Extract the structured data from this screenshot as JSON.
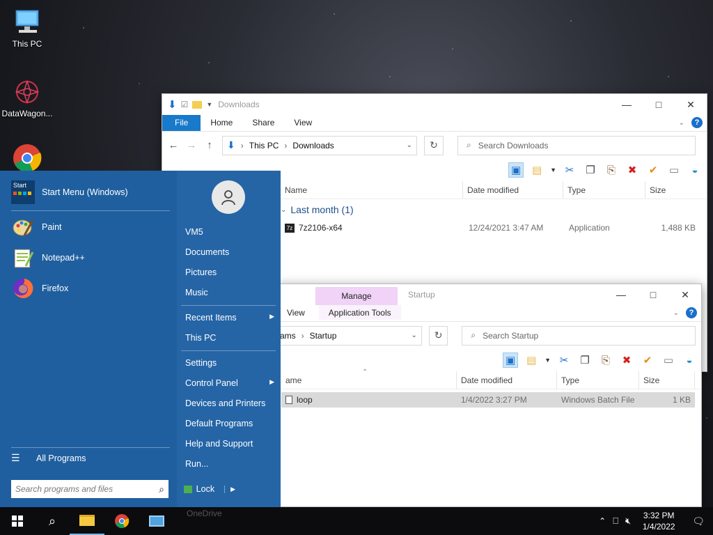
{
  "desktop": {
    "icons": [
      {
        "label": "This PC",
        "icon": "this-pc-icon"
      },
      {
        "label": "DataWagon...",
        "icon": "datawagon-icon"
      },
      {
        "label": "",
        "icon": "chrome-icon"
      }
    ]
  },
  "downloads_window": {
    "title": "Downloads",
    "tabs": {
      "file": "File",
      "home": "Home",
      "share": "Share",
      "view": "View"
    },
    "address": {
      "root": "This PC",
      "folder": "Downloads"
    },
    "search_placeholder": "Search Downloads",
    "columns": {
      "name": "Name",
      "date": "Date modified",
      "type": "Type",
      "size": "Size"
    },
    "group": "Last month (1)",
    "rows": [
      {
        "name": "7z2106-x64",
        "date": "12/24/2021 3:47 AM",
        "type": "Application",
        "size": "1,488 KB"
      }
    ]
  },
  "startup_window": {
    "title": "Startup",
    "tabs": {
      "view": "View",
      "manage": "Manage",
      "app_tools": "Application Tools"
    },
    "address": {
      "parent": "ams",
      "folder": "Startup"
    },
    "search_placeholder": "Search Startup",
    "columns": {
      "name": "ame",
      "date": "Date modified",
      "type": "Type",
      "size": "Size"
    },
    "rows": [
      {
        "name": "loop",
        "date": "1/4/2022 3:27 PM",
        "type": "Windows Batch File",
        "size": "1 KB"
      }
    ]
  },
  "start_menu": {
    "header": "Start Menu (Windows)",
    "start_badge": "Start",
    "pinned": [
      {
        "label": "Paint",
        "icon": "paint-icon"
      },
      {
        "label": "Notepad++",
        "icon": "notepadpp-icon"
      },
      {
        "label": "Firefox",
        "icon": "firefox-icon"
      }
    ],
    "all_programs": "All Programs",
    "search_placeholder": "Search programs and files",
    "right_items": [
      {
        "label": "VM5",
        "arrow": false
      },
      {
        "label": "Documents",
        "arrow": false
      },
      {
        "label": "Pictures",
        "arrow": false
      },
      {
        "label": "Music",
        "arrow": false
      },
      {
        "label": "Recent Items",
        "arrow": true
      },
      {
        "label": "This PC",
        "arrow": false
      },
      {
        "label": "Settings",
        "arrow": false
      },
      {
        "label": "Control Panel",
        "arrow": true
      },
      {
        "label": "Devices and Printers",
        "arrow": false
      },
      {
        "label": "Default Programs",
        "arrow": false
      },
      {
        "label": "Help and Support",
        "arrow": false
      },
      {
        "label": "Run...",
        "arrow": false
      }
    ],
    "lock": "Lock"
  },
  "taskbar": {
    "behind_text": "OneDrive",
    "time": "3:32 PM",
    "date": "1/4/2022"
  },
  "colors": {
    "start_bg": "#2565a6",
    "accent": "#1979ca",
    "manage_tab": "#f0d3f7",
    "selected_row": "#d9d9d9"
  }
}
